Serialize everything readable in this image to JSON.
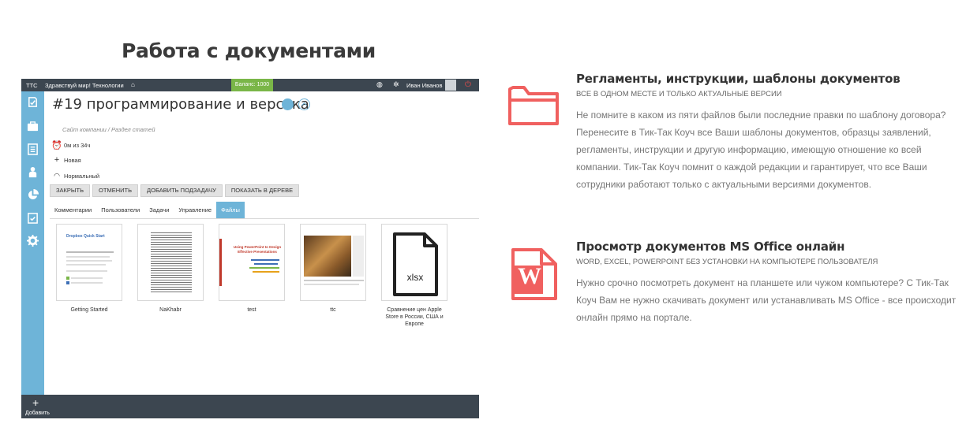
{
  "section": {
    "title": "Работа с документами"
  },
  "app": {
    "topbar": {
      "logo": "TTC",
      "greeting": "Здравствуй мир! Технологии",
      "balance": "Баланс: 1000",
      "user_name": "Иван Иванов"
    },
    "bottombar": {
      "add_label": "Добавить"
    },
    "task": {
      "title": "#19 программирование и верстка",
      "breadcrumb": "Сайт компании / Раздел статей",
      "time": "0м из 34ч",
      "status": "Новая",
      "priority": "Нормальный"
    },
    "actions": [
      "ЗАКРЫТЬ",
      "ОТМЕНИТЬ",
      "ДОБАВИТЬ ПОДЗАДАЧУ",
      "ПОКАЗАТЬ В ДЕРЕВЕ"
    ],
    "tabs": [
      "Комментарии",
      "Пользователи",
      "Задачи",
      "Управление",
      "Файлы"
    ],
    "active_tab": "Файлы",
    "files": [
      {
        "name": "Getting Started",
        "thumb_title": "Dropbox Quick Start"
      },
      {
        "name": "NaKhabr"
      },
      {
        "name": "test",
        "thumb_title": "Using PowerPoint to Design Effective Presentations"
      },
      {
        "name": "ttc"
      },
      {
        "name": "Сравнение цен Apple Store в России, США и Европе",
        "thumb_label": "xlsx"
      }
    ],
    "colors": {
      "sidebar": "#6eb4d8",
      "topbar": "#3c4650",
      "balance": "#7ab648",
      "power": "#e84a4a"
    }
  },
  "features": [
    {
      "icon": "folder-icon",
      "title": "Регламенты, инструкции, шаблоны документов",
      "subtitle": "ВСЕ В ОДНОМ МЕСТЕ И ТОЛЬКО АКТУАЛЬНЫЕ ВЕРСИИ",
      "text": "Не помните в каком из пяти файлов были последние правки по шаблону договора? Перенесите в Тик-Так Коуч все Ваши шаблоны документов, образцы заявлений, регламенты, инструкции и другую информацию, имеющую отношение ко всей компании. Тик-Так Коуч помнит о каждой редакции и гарантирует, что все Ваши сотрудники работают только с актуальными версиями документов."
    },
    {
      "icon": "word-document-icon",
      "title": "Просмотр документов MS Office онлайн",
      "subtitle": "WORD, EXCEL, POWERPOINT БЕЗ УСТАНОВКИ НА КОМПЬЮТЕРЕ ПОЛЬЗОВАТЕЛЯ",
      "text": "Нужно срочно посмотреть документ на планшете или чужом компьютере? С Тик-Так Коуч Вам не нужно скачивать документ или устанавливать MS Office - все происходит онлайн прямо на портале.",
      "icon_letter": "W"
    }
  ],
  "accent_color": "#f0605f"
}
